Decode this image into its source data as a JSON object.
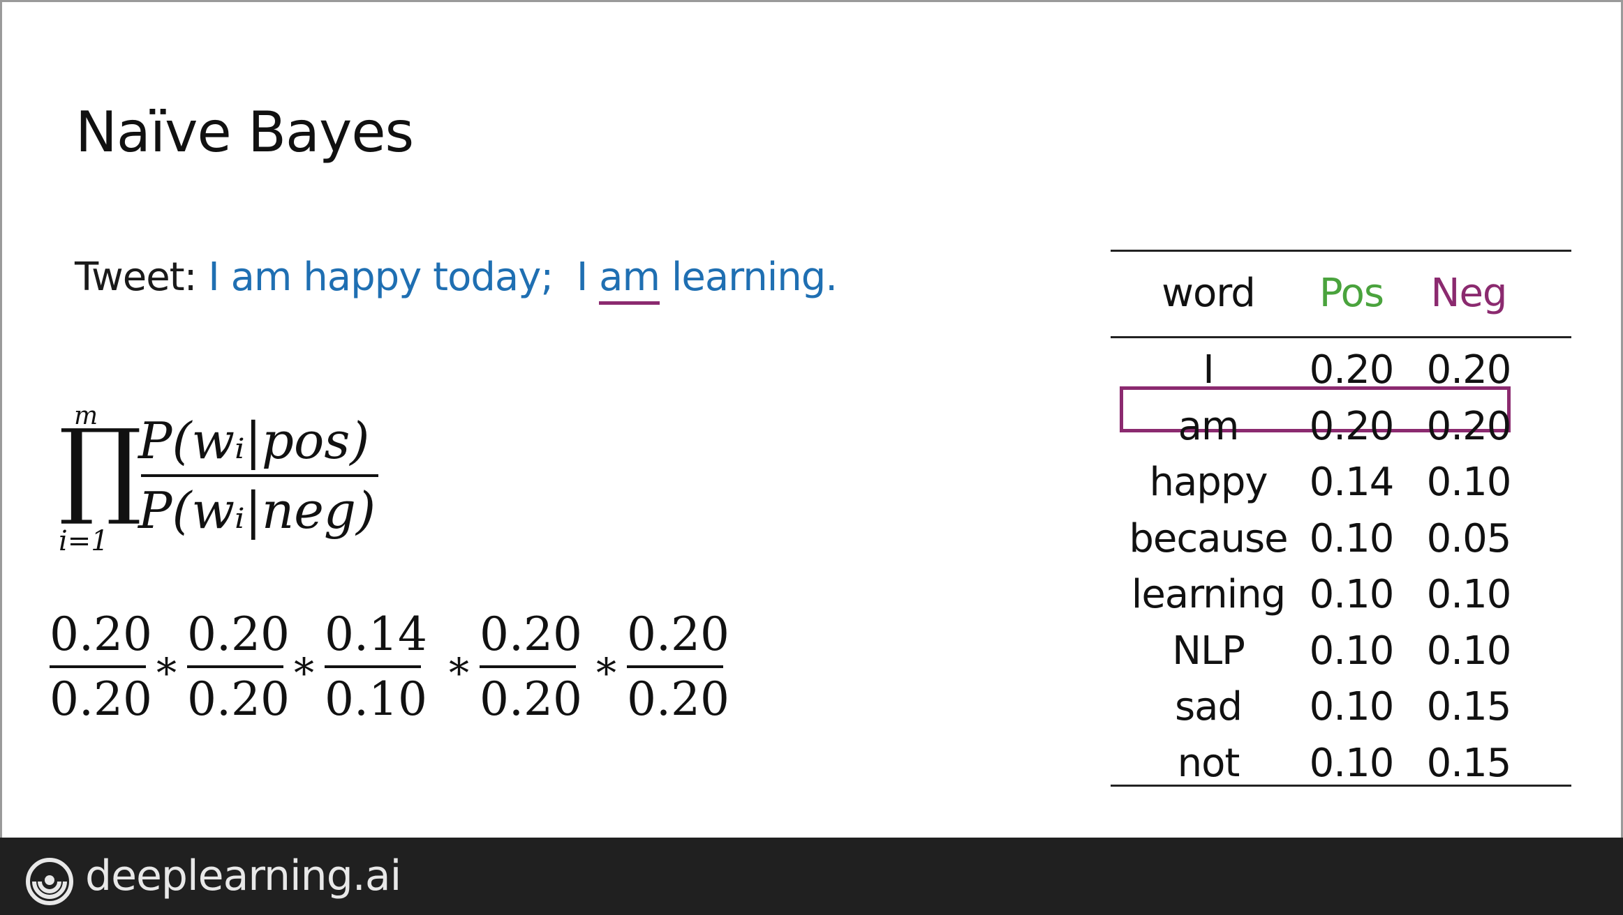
{
  "slide": {
    "title": "Naïve Bayes",
    "tweet": {
      "label": "Tweet:",
      "part1": "I am happy today;",
      "part2_i": "I",
      "part2_am": "am",
      "part2_rest": "learning."
    },
    "formula": {
      "upper": "m",
      "product": "∏",
      "lower": "i=1",
      "numerator": "P(wᵢ|pos)",
      "denominator": "P(wᵢ|neg)"
    },
    "calculation": {
      "operator": "*",
      "fractions": [
        {
          "num": "0.20",
          "den": "0.20"
        },
        {
          "num": "0.20",
          "den": "0.20"
        },
        {
          "num": "0.14",
          "den": "0.10"
        },
        {
          "num": "0.20",
          "den": "0.20"
        },
        {
          "num": "0.20",
          "den": "0.20"
        }
      ]
    },
    "table": {
      "headers": {
        "word": "word",
        "pos": "Pos",
        "neg": "Neg"
      },
      "rows": [
        {
          "word": "I",
          "pos": "0.20",
          "neg": "0.20"
        },
        {
          "word": "am",
          "pos": "0.20",
          "neg": "0.20"
        },
        {
          "word": "happy",
          "pos": "0.14",
          "neg": "0.10"
        },
        {
          "word": "because",
          "pos": "0.10",
          "neg": "0.05"
        },
        {
          "word": "learning",
          "pos": "0.10",
          "neg": "0.10"
        },
        {
          "word": "NLP",
          "pos": "0.10",
          "neg": "0.10"
        },
        {
          "word": "sad",
          "pos": "0.10",
          "neg": "0.15"
        },
        {
          "word": "not",
          "pos": "0.10",
          "neg": "0.15"
        }
      ],
      "highlighted_word": "am"
    }
  },
  "footer": {
    "brand": "deeplearning.ai",
    "logo_icon": "deeplearning-logo-icon"
  },
  "colors": {
    "tweet_text": "#1f6fb2",
    "pos": "#4aa33d",
    "neg": "#8b2a6f",
    "footer_bg": "#202020"
  }
}
